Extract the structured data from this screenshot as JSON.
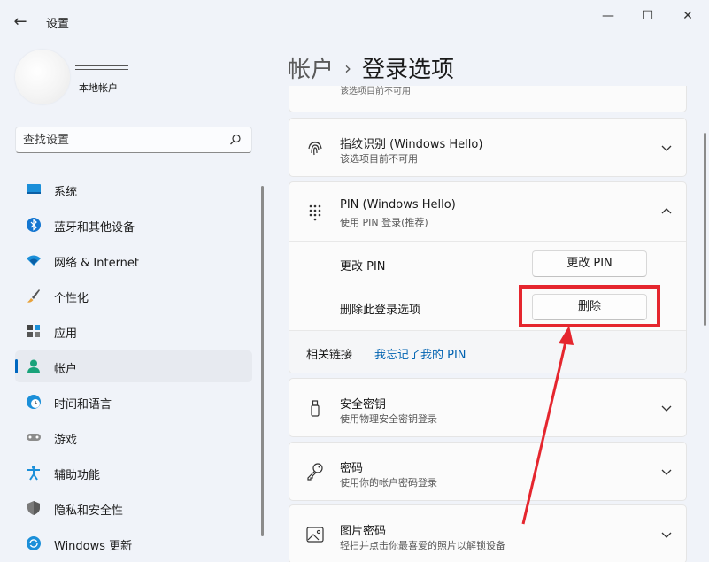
{
  "window": {
    "title": "设置",
    "back_icon": "back-arrow-icon",
    "minimize_icon": "minimize-icon",
    "maximize_icon": "maximize-icon",
    "close_icon": "close-icon"
  },
  "profile": {
    "account_name": "本地帐户"
  },
  "search": {
    "placeholder": "查找设置",
    "icon": "search-icon"
  },
  "nav": {
    "items": [
      {
        "label": "系统",
        "icon": "system-icon",
        "active": false
      },
      {
        "label": "蓝牙和其他设备",
        "icon": "bluetooth-icon",
        "active": false
      },
      {
        "label": "网络 & Internet",
        "icon": "network-icon",
        "active": false
      },
      {
        "label": "个性化",
        "icon": "personalization-icon",
        "active": false
      },
      {
        "label": "应用",
        "icon": "apps-icon",
        "active": false
      },
      {
        "label": "帐户",
        "icon": "accounts-icon",
        "active": true
      },
      {
        "label": "时间和语言",
        "icon": "time-language-icon",
        "active": false
      },
      {
        "label": "游戏",
        "icon": "gaming-icon",
        "active": false
      },
      {
        "label": "辅助功能",
        "icon": "accessibility-icon",
        "active": false
      },
      {
        "label": "隐私和安全性",
        "icon": "privacy-icon",
        "active": false
      },
      {
        "label": "Windows 更新",
        "icon": "windows-update-icon",
        "active": false
      }
    ]
  },
  "breadcrumb": {
    "parent": "帐户",
    "separator": "›",
    "current": "登录选项"
  },
  "sign_in_options": {
    "partial_top_text": "该选项目前不可用",
    "fingerprint": {
      "title": "指纹识别 (Windows Hello)",
      "subtitle": "该选项目前不可用",
      "icon": "fingerprint-icon"
    },
    "pin": {
      "title": "PIN (Windows Hello)",
      "subtitle": "使用 PIN 登录(推荐)",
      "icon": "pin-keypad-icon",
      "change_label": "更改 PIN",
      "change_button": "更改 PIN",
      "remove_label": "删除此登录选项",
      "remove_button": "删除",
      "related_label": "相关链接",
      "forgot_link": "我忘记了我的 PIN"
    },
    "security_key": {
      "title": "安全密钥",
      "subtitle": "使用物理安全密钥登录",
      "icon": "usb-key-icon"
    },
    "password": {
      "title": "密码",
      "subtitle": "使用你的帐户密码登录",
      "icon": "key-icon"
    },
    "picture_password": {
      "title": "图片密码",
      "subtitle": "轻扫并点击你最喜爱的照片以解锁设备",
      "icon": "picture-icon"
    }
  },
  "colors": {
    "accent": "#0067c0",
    "annotation": "#e5262e",
    "link": "#0063b1"
  }
}
